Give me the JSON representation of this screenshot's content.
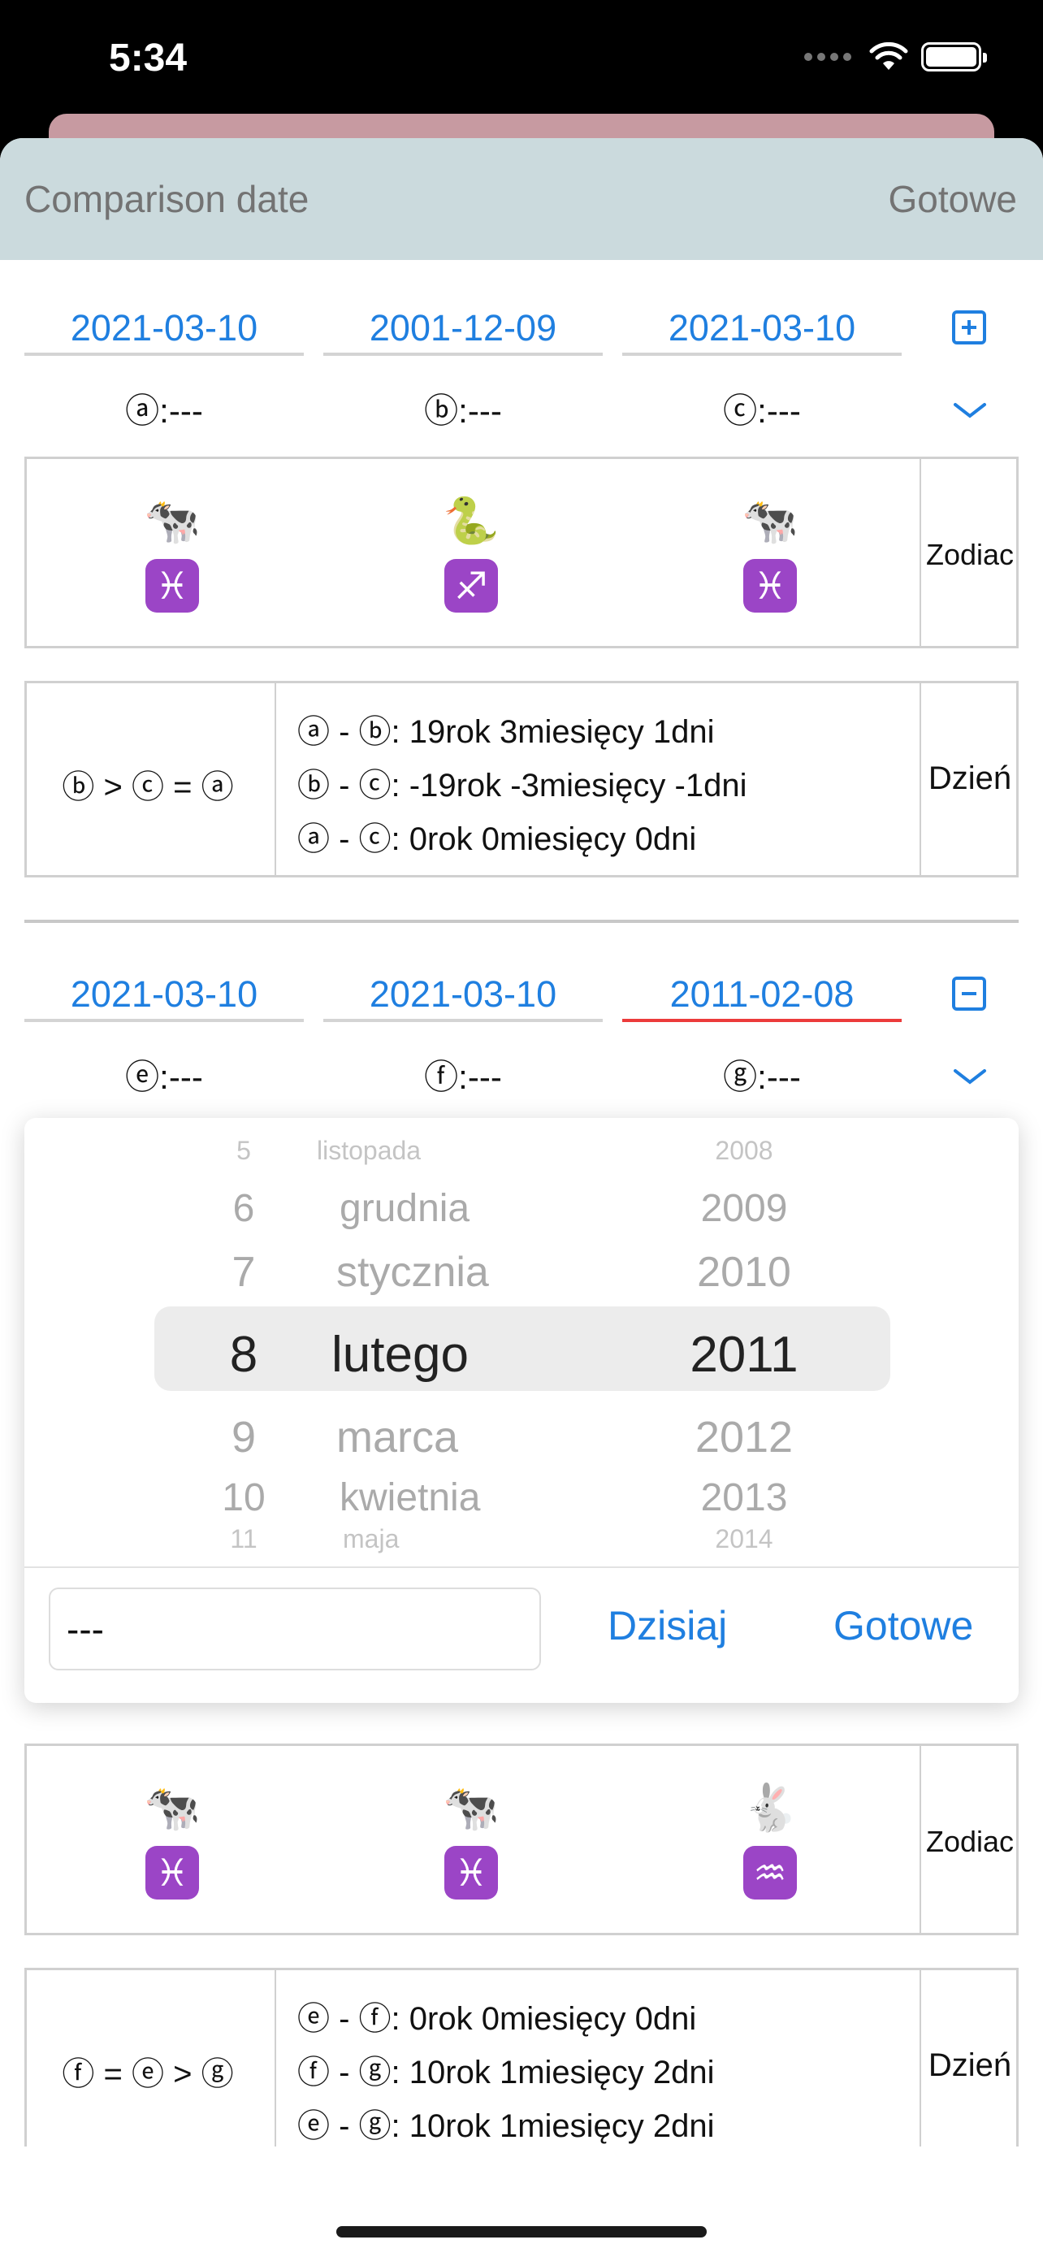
{
  "status_bar": {
    "time": "5:34"
  },
  "sheet": {
    "title": "Comparison date",
    "done": "Gotowe"
  },
  "group1": {
    "dates": [
      "2021-03-10",
      "2001-12-09",
      "2021-03-10"
    ],
    "labels": [
      "ⓐ:---",
      "ⓑ:---",
      "ⓒ:---"
    ],
    "zodiac_animals": [
      "🐄",
      "🐍",
      "🐄"
    ],
    "zodiac_signs": [
      "♓",
      "♐",
      "♓"
    ],
    "zodiac_label": "Zodiac",
    "relation": "ⓑ > ⓒ = ⓐ",
    "diffs": [
      "ⓐ - ⓑ: 19rok 3miesięcy 1dni",
      "ⓑ - ⓒ: -19rok -3miesięcy -1dni",
      "ⓐ - ⓒ: 0rok 0miesięcy 0dni"
    ],
    "day_label": "Dzień"
  },
  "group2": {
    "dates": [
      "2021-03-10",
      "2021-03-10",
      "2011-02-08"
    ],
    "labels": [
      "ⓔ:---",
      "ⓕ:---",
      "ⓖ:---"
    ],
    "zodiac_animals": [
      "🐄",
      "🐄",
      "🐇"
    ],
    "zodiac_signs": [
      "♓",
      "♓",
      "♒"
    ],
    "zodiac_label": "Zodiac",
    "relation": "ⓕ = ⓔ > ⓖ",
    "diffs": [
      "ⓔ - ⓕ: 0rok 0miesięcy 0dni",
      "ⓕ - ⓖ: 10rok 1miesięcy 2dni",
      "ⓔ - ⓖ: 10rok 1miesięcy 2dni"
    ],
    "day_label": "Dzień"
  },
  "picker": {
    "days": [
      "5",
      "6",
      "7",
      "8",
      "9",
      "10",
      "11"
    ],
    "months": [
      "listopada",
      "grudnia",
      "stycznia",
      "lutego",
      "marca",
      "kwietnia",
      "maja"
    ],
    "years": [
      "2008",
      "2009",
      "2010",
      "2011",
      "2012",
      "2013",
      "2014"
    ],
    "input_value": "---",
    "today_label": "Dzisiaj",
    "done_label": "Gotowe"
  },
  "colors": {
    "accent": "#1f7fe0",
    "header_bg": "#cbdadd",
    "active_underline": "#ec3b3b",
    "sign_bg": "#9b45c6"
  },
  "icons": {
    "add": "plus-square-icon",
    "remove": "minus-square-icon",
    "expand": "chevron-down-icon"
  }
}
